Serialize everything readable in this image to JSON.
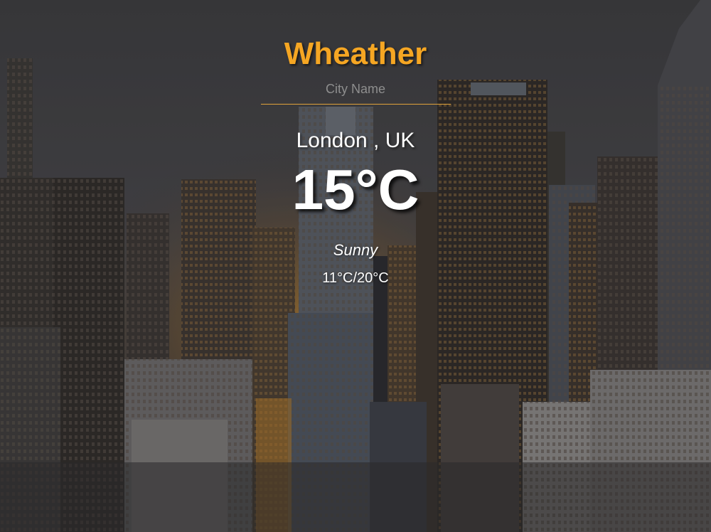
{
  "app": {
    "title": "Wheather"
  },
  "search": {
    "placeholder": "City Name",
    "value": ""
  },
  "weather": {
    "location": "London , UK",
    "temperature": "15°C",
    "condition": "Sunny",
    "range": "11°C/20°C"
  },
  "colors": {
    "accent": "#f5a623",
    "text": "#ffffff",
    "placeholder": "#8e8e8e"
  },
  "background": {
    "description_icon": "city-skyline-photo"
  }
}
